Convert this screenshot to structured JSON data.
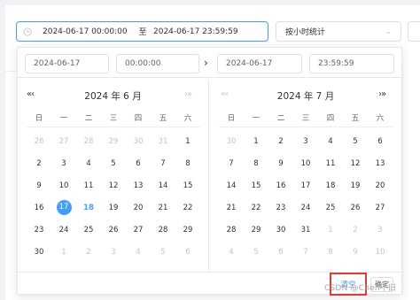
{
  "range": {
    "start": "2024-06-17 00:00:00",
    "separator": "至",
    "end": "2024-06-17 23:59:59"
  },
  "stat_select": {
    "value": "按小时统计"
  },
  "picker": {
    "start_date": "2024-06-17",
    "start_time": "00:00:00",
    "end_date": "2024-06-17",
    "end_time": "23:59:59",
    "weekdays": [
      "日",
      "一",
      "二",
      "三",
      "四",
      "五",
      "六"
    ],
    "left": {
      "title": "2024 年 6 月",
      "prev_label": "«‹",
      "weeks": [
        [
          {
            "d": "26",
            "m": true
          },
          {
            "d": "27",
            "m": true
          },
          {
            "d": "28",
            "m": true
          },
          {
            "d": "29",
            "m": true
          },
          {
            "d": "30",
            "m": true
          },
          {
            "d": "31",
            "m": true
          },
          {
            "d": "1"
          }
        ],
        [
          {
            "d": "2"
          },
          {
            "d": "3"
          },
          {
            "d": "4"
          },
          {
            "d": "5"
          },
          {
            "d": "6"
          },
          {
            "d": "7"
          },
          {
            "d": "8"
          }
        ],
        [
          {
            "d": "9"
          },
          {
            "d": "10"
          },
          {
            "d": "11"
          },
          {
            "d": "12"
          },
          {
            "d": "13"
          },
          {
            "d": "14"
          },
          {
            "d": "15"
          }
        ],
        [
          {
            "d": "16"
          },
          {
            "d": "17",
            "sel": true
          },
          {
            "d": "18",
            "today": true
          },
          {
            "d": "19"
          },
          {
            "d": "20"
          },
          {
            "d": "21"
          },
          {
            "d": "22"
          }
        ],
        [
          {
            "d": "23"
          },
          {
            "d": "24"
          },
          {
            "d": "25"
          },
          {
            "d": "26"
          },
          {
            "d": "27"
          },
          {
            "d": "28"
          },
          {
            "d": "29"
          }
        ],
        [
          {
            "d": "30"
          },
          {
            "d": "1",
            "m": true
          },
          {
            "d": "2",
            "m": true
          },
          {
            "d": "3",
            "m": true
          },
          {
            "d": "4",
            "m": true
          },
          {
            "d": "5",
            "m": true
          },
          {
            "d": "6",
            "m": true
          }
        ]
      ]
    },
    "right": {
      "title": "2024 年 7 月",
      "prev_label": "«‹",
      "next_label": "›»",
      "weeks": [
        [
          {
            "d": "30",
            "m": true
          },
          {
            "d": "1"
          },
          {
            "d": "2"
          },
          {
            "d": "3"
          },
          {
            "d": "4"
          },
          {
            "d": "5"
          },
          {
            "d": "6"
          }
        ],
        [
          {
            "d": "7"
          },
          {
            "d": "8"
          },
          {
            "d": "9"
          },
          {
            "d": "10"
          },
          {
            "d": "11"
          },
          {
            "d": "12"
          },
          {
            "d": "13"
          }
        ],
        [
          {
            "d": "14"
          },
          {
            "d": "15"
          },
          {
            "d": "16"
          },
          {
            "d": "17"
          },
          {
            "d": "18"
          },
          {
            "d": "19"
          },
          {
            "d": "20"
          }
        ],
        [
          {
            "d": "21"
          },
          {
            "d": "22"
          },
          {
            "d": "23"
          },
          {
            "d": "24"
          },
          {
            "d": "25"
          },
          {
            "d": "26"
          },
          {
            "d": "27"
          }
        ],
        [
          {
            "d": "28"
          },
          {
            "d": "29"
          },
          {
            "d": "30"
          },
          {
            "d": "31"
          },
          {
            "d": "1",
            "m": true
          },
          {
            "d": "2",
            "m": true
          },
          {
            "d": "3",
            "m": true
          }
        ],
        [
          {
            "d": "4",
            "m": true
          },
          {
            "d": "5",
            "m": true
          },
          {
            "d": "6",
            "m": true
          },
          {
            "d": "7",
            "m": true
          },
          {
            "d": "8",
            "m": true
          },
          {
            "d": "9",
            "m": true
          },
          {
            "d": "10",
            "m": true
          }
        ]
      ]
    },
    "clear_label": "清空",
    "ok_label": "确定"
  },
  "watermark": "CSDN @Chen不旧",
  "colors": {
    "accent": "#409eff",
    "highlight_box": "#e53935"
  }
}
